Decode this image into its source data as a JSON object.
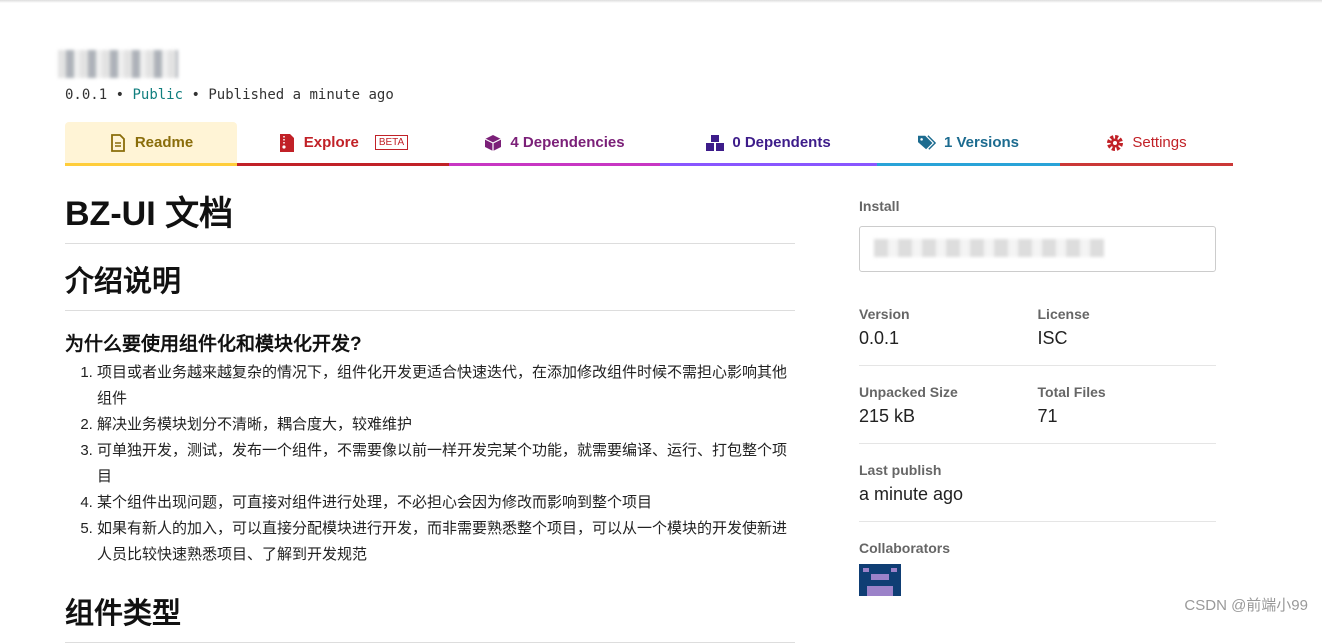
{
  "package": {
    "version": "0.0.1",
    "visibility": "Public",
    "published": "Published a minute ago",
    "sep": "•"
  },
  "tabs": [
    {
      "label": "Readme",
      "color": "#8a6d0b",
      "border": "#ffcd3a",
      "bg": "#fff4d6"
    },
    {
      "label": "Explore",
      "badge": "BETA",
      "color": "#c12127",
      "border": "#c12127"
    },
    {
      "label": "4 Dependencies",
      "color": "#7b2078",
      "border": "#c836c3"
    },
    {
      "label": "0 Dependents",
      "color": "#3d1c8a",
      "border": "#8956ff"
    },
    {
      "label": "1 Versions",
      "color": "#1c6b8f",
      "border": "#29a3d8"
    },
    {
      "label": "Settings",
      "color": "#c12127",
      "border": "#cb3837"
    }
  ],
  "readme": {
    "title": "BZ-UI 文档",
    "h2_intro": "介绍说明",
    "h3_why": "为什么要使用组件化和模块化开发?",
    "items": [
      "项目或者业务越来越复杂的情况下，组件化开发更适合快速迭代，在添加修改组件时候不需担心影响其他组件",
      "解决业务模块划分不清晰，耦合度大，较难维护",
      "可单独开发，测试，发布一个组件，不需要像以前一样开发完某个功能，就需要编译、运行、打包整个项目",
      "某个组件出现问题，可直接对组件进行处理，不必担心会因为修改而影响到整个项目",
      "如果有新人的加入，可以直接分配模块进行开发，而非需要熟悉整个项目，可以从一个模块的开发使新进人员比较快速熟悉项目、了解到开发规范"
    ],
    "h2_types": "组件类型"
  },
  "sidebar": {
    "install_label": "Install",
    "version_label": "Version",
    "version": "0.0.1",
    "license_label": "License",
    "license": "ISC",
    "size_label": "Unpacked Size",
    "size": "215 kB",
    "files_label": "Total Files",
    "files": "71",
    "last_label": "Last publish",
    "last": "a minute ago",
    "collab_label": "Collaborators"
  },
  "watermark": "CSDN @前端小99"
}
